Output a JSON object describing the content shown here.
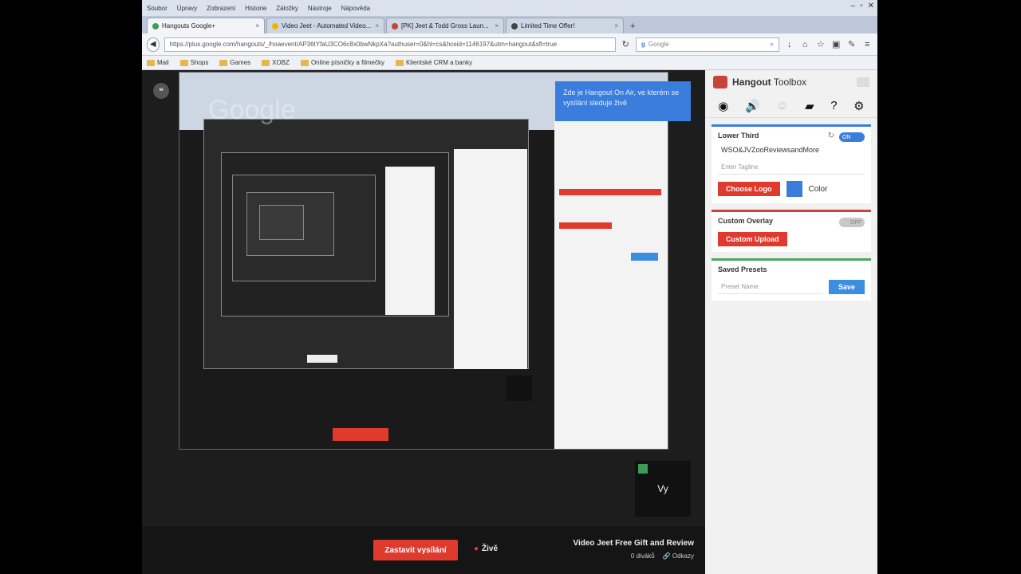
{
  "browser": {
    "menu": [
      "Soubor",
      "Úpravy",
      "Zobrazení",
      "Historie",
      "Záložky",
      "Nástroje",
      "Nápověda"
    ],
    "tabs": [
      {
        "label": "Hangouts Google+",
        "color": "#3d9a57"
      },
      {
        "label": "Video Jeet - Automated Video...",
        "color": "#f0b400"
      },
      {
        "label": "[PK] Jeet & Todd Gross Laun...",
        "color": "#c7443a"
      },
      {
        "label": "Limited Time Offer!",
        "color": "#444444"
      }
    ],
    "url": "https://plus.google.com/hangouts/_/hoaevent/AP36tYfaU3CO6c8x0bwNkpXa?authuser=0&hl=cs&hceid=1146197&utm=hangout&sfl=true",
    "search_placeholder": "Google",
    "bookmarks": [
      "Mail",
      "Shops",
      "Games",
      "XOBZ",
      "Online písničky a filmečky",
      "Klientské CRM a banky"
    ]
  },
  "hangout": {
    "watermark": "Google",
    "tooltip": "Zde je Hangout On Air, ve kterém se vysílání sleduje živě",
    "self_label": "Vy",
    "stop_button": "Zastavit vysílání",
    "live_label": "Živě",
    "event_title": "Video Jeet Free Gift and Review",
    "viewers": "0 diváků",
    "links": "Odkazy"
  },
  "toolbox": {
    "title_bold": "Hangout",
    "title_rest": " Toolbox",
    "icons": [
      "person-icon",
      "speaker-icon",
      "face-icon",
      "comment-icon",
      "help-icon",
      "gear-icon"
    ],
    "lower_third": {
      "heading": "Lower Third",
      "toggle": "ON",
      "name": "WSO&JVZooReviewsandMore",
      "tagline_placeholder": "Enter Tagline",
      "choose_logo": "Choose Logo",
      "color_label": "Color",
      "color": "#3b7ddd"
    },
    "custom_overlay": {
      "heading": "Custom Overlay",
      "toggle": "OFF",
      "upload": "Custom Upload"
    },
    "saved_presets": {
      "heading": "Saved Presets",
      "placeholder": "Preset Name",
      "save": "Save"
    }
  }
}
